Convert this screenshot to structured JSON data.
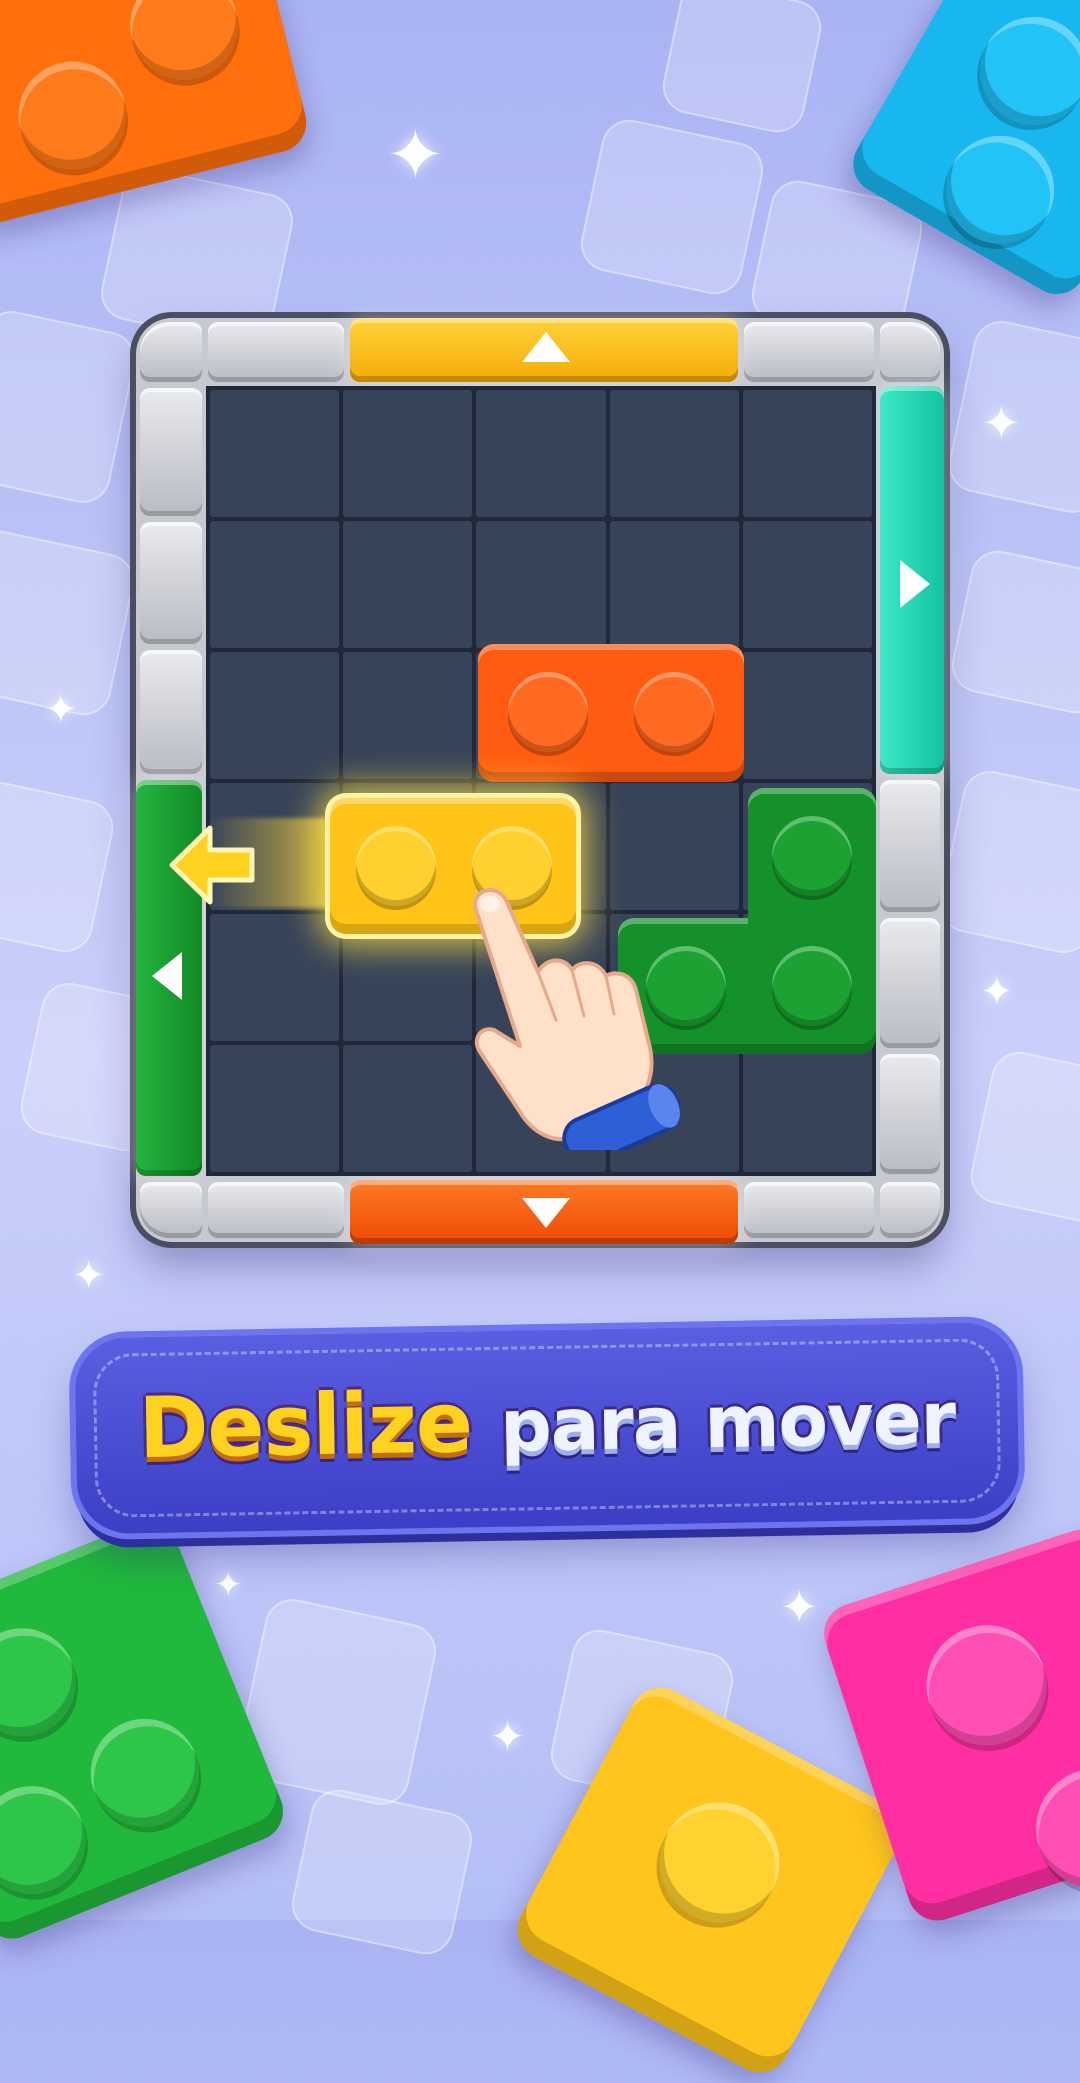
{
  "banner": {
    "word1": "Deslize",
    "word2": "para mover"
  },
  "colors": {
    "background": "#b9c3f6",
    "board_frame": "#c7c9d0",
    "grid_dark": "#20283a",
    "cell": "#364359",
    "gate_top": "#ffc21a",
    "gate_right": "#1fd7b4",
    "gate_left": "#159a2c",
    "gate_bottom": "#ff5a0a",
    "block_orange": "#ff5b12",
    "block_yellow": "#ffc417",
    "block_green": "#14912a",
    "banner": "#4447cf"
  },
  "board": {
    "columns": 5,
    "rows": 6,
    "gates": [
      {
        "side": "top",
        "color": "yellow",
        "arrow": "up"
      },
      {
        "side": "right",
        "color": "teal",
        "arrow": "right"
      },
      {
        "side": "left",
        "color": "green",
        "arrow": "left"
      },
      {
        "side": "bottom",
        "color": "orange",
        "arrow": "down"
      }
    ],
    "blocks": [
      {
        "color": "orange",
        "shape": "1x2 horizontal",
        "studs": 2
      },
      {
        "color": "yellow",
        "shape": "1x2 horizontal",
        "studs": 2,
        "state": "selected, moving left"
      },
      {
        "color": "green",
        "shape": "L",
        "studs": 3
      }
    ]
  },
  "icons": [
    "swipe-left-arrow-icon",
    "pointing-hand-icon",
    "sparkle-icon"
  ]
}
